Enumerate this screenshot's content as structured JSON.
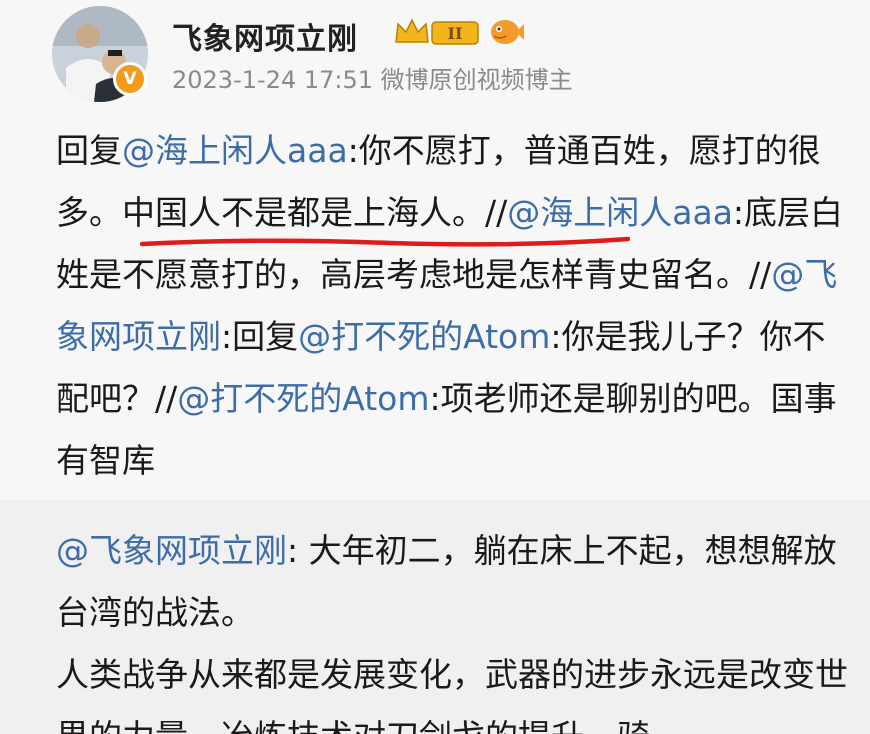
{
  "header": {
    "username": "飞象网项立刚",
    "timestamp": "2023-1-24 17:51",
    "source": "微博原创视频博主",
    "badge_level": "II",
    "verify_mark": "V",
    "icons": [
      "avatar",
      "verified-badge-icon",
      "crown-level-badge-icon",
      "fish-badge-icon"
    ]
  },
  "post": {
    "segments": [
      {
        "t": "回复",
        "m": false
      },
      {
        "t": "@海上闲人aaa",
        "m": true
      },
      {
        "t": ":你不愿打，普通百姓，愿打的很多。中国人不是都是上海人。//",
        "m": false
      },
      {
        "t": "@海上闲人aaa",
        "m": true
      },
      {
        "t": ":底层白姓是不愿意打的，高层考虑地是怎样青史留名。//",
        "m": false
      },
      {
        "t": "@飞象网项立刚",
        "m": true
      },
      {
        "t": ":回复",
        "m": false
      },
      {
        "t": "@打不死的Atom",
        "m": true
      },
      {
        "t": ":你是我儿子？你不配吧？//",
        "m": false
      },
      {
        "t": "@打不死的Atom",
        "m": true
      },
      {
        "t": ":项老师还是聊别的吧。国事有智库",
        "m": false
      }
    ]
  },
  "quote": {
    "mention": "@飞象网项立刚",
    "line1_rest": ": 大年初二，躺在床上不起，想想解放台湾的战法。",
    "line2": "人类战争从来都是发展变化，武器的进步永远是改变世界的力量，冶炼技术对刀剑戈的提升，骑"
  },
  "colors": {
    "mention": "#3c6da8",
    "underline": "#e01b1b",
    "meta": "#8a8a8a",
    "quote_bg": "#f0f0f0"
  }
}
